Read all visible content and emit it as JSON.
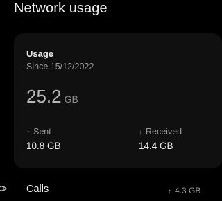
{
  "header": {
    "title": "Network usage"
  },
  "usage": {
    "label": "Usage",
    "since": "Since 15/12/2022",
    "total_value": "25.2",
    "total_unit": "GB"
  },
  "sent": {
    "label": "Sent",
    "value": "10.8 GB",
    "icon": "arrow-up-icon"
  },
  "received": {
    "label": "Received",
    "value": "14.4 GB",
    "icon": "arrow-down-icon"
  },
  "calls": {
    "label": "Calls",
    "value": "4.3 GB",
    "icon": "arrow-up-icon"
  },
  "colors": {
    "background": "#000000",
    "card": "#101010",
    "text": "#ececec",
    "muted": "#9a9a9a"
  }
}
